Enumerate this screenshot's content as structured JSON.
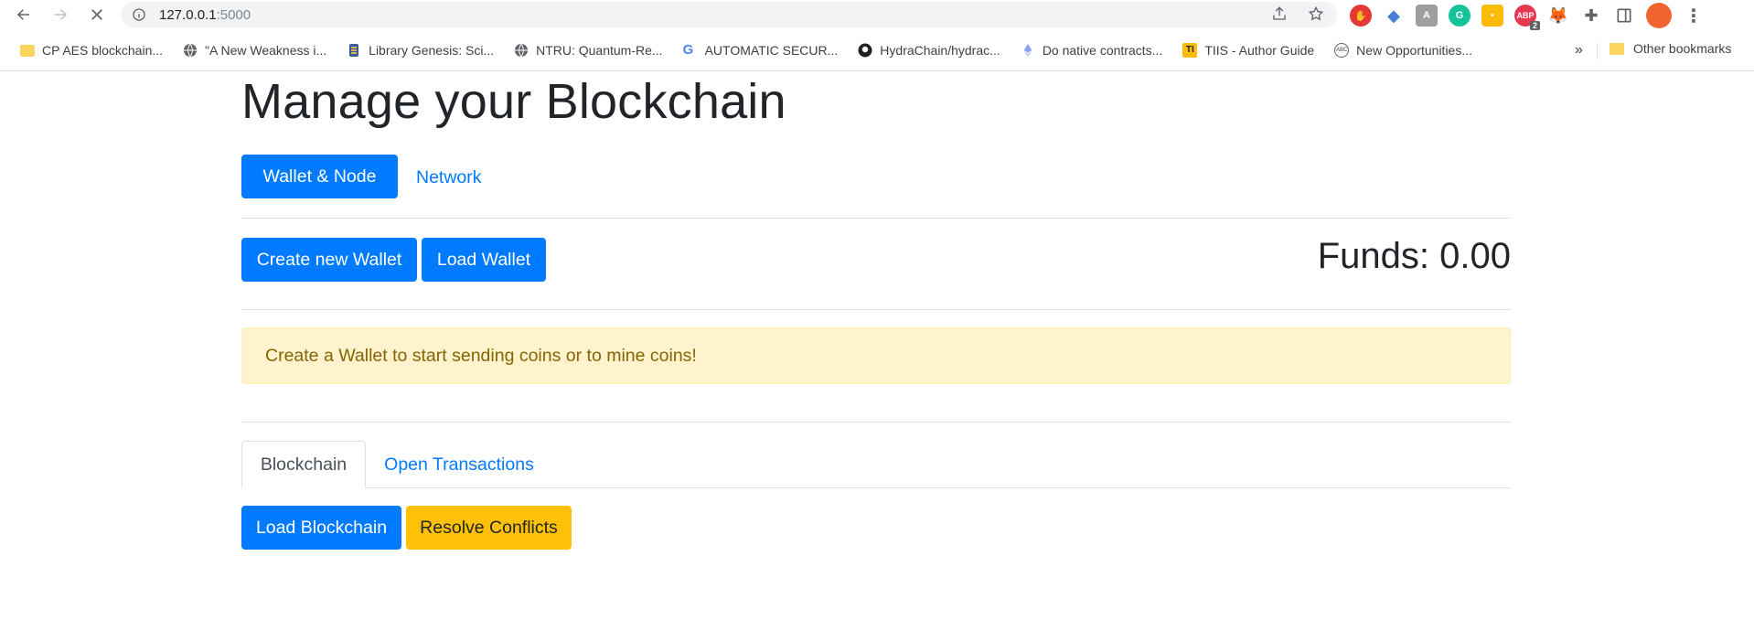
{
  "browser": {
    "url_host": "127.0.0.1",
    "url_port": ":5000",
    "extensions": [
      {
        "name": "ext-red-hand",
        "color": "#e53935"
      },
      {
        "name": "ext-blue-cap",
        "color": "#4a7fd6"
      },
      {
        "name": "ext-pdf",
        "color": "#9e9e9e"
      },
      {
        "name": "ext-grammarly",
        "color": "#15c39a"
      },
      {
        "name": "ext-keep",
        "color": "#fbbc04"
      },
      {
        "name": "ext-abp",
        "color": "#e8384f",
        "badge": "2",
        "label": "ABP"
      },
      {
        "name": "ext-metamask",
        "color": "#e2761b"
      }
    ],
    "bookmarks": [
      {
        "label": "CP AES blockchain...",
        "icon": "folder-icon"
      },
      {
        "label": "\"A New Weakness i...",
        "icon": "globe-icon"
      },
      {
        "label": "Library Genesis: Sci...",
        "icon": "libgen-icon"
      },
      {
        "label": "NTRU: Quantum-Re...",
        "icon": "globe-icon"
      },
      {
        "label": "AUTOMATIC SECUR...",
        "icon": "google-icon"
      },
      {
        "label": "HydraChain/hydrac...",
        "icon": "github-icon"
      },
      {
        "label": "Do native contracts...",
        "icon": "ethereum-icon"
      },
      {
        "label": "TIIS - Author Guide",
        "icon": "tiis-icon"
      },
      {
        "label": "New Opportunities...",
        "icon": "abc-icon"
      }
    ],
    "more_label": "»",
    "other_bookmarks": "Other bookmarks"
  },
  "page": {
    "title": "Manage your Blockchain",
    "nav": {
      "wallet_node": "Wallet & Node",
      "network": "Network"
    },
    "wallet": {
      "create": "Create new Wallet",
      "load": "Load Wallet",
      "funds": "Funds: 0.00"
    },
    "alert": "Create a Wallet to start sending coins or to mine coins!",
    "tabs": {
      "blockchain": "Blockchain",
      "open_transactions": "Open Transactions"
    },
    "actions": {
      "load_blockchain": "Load Blockchain",
      "resolve_conflicts": "Resolve Conflicts"
    }
  },
  "colors": {
    "primary": "#007bff",
    "warning": "#ffc107",
    "alert_bg": "#fff3cd",
    "alert_text": "#856404"
  }
}
